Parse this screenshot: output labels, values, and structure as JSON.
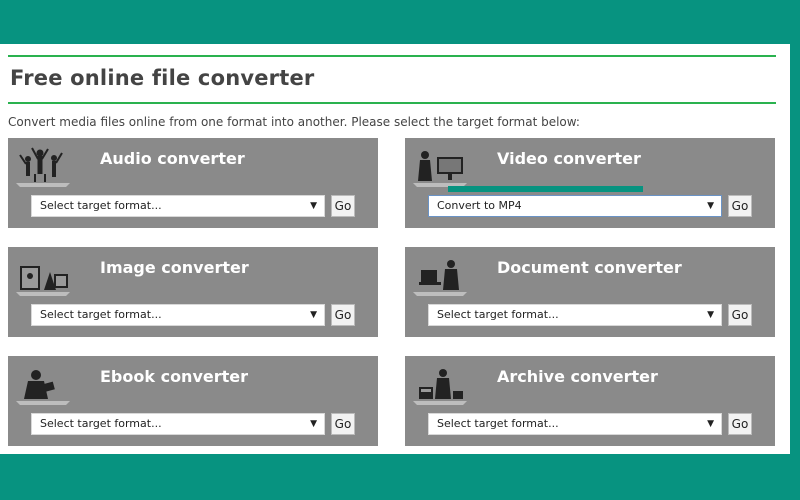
{
  "header": {
    "title": "Free online file converter",
    "subtitle": "Convert media files online from one format into another. Please select the target format below:"
  },
  "colors": {
    "background": "#079380",
    "panel": "#8a8a8a",
    "rule": "#2ab24f"
  },
  "panels": [
    {
      "title": "Audio converter",
      "select": "Select target format...",
      "go": "Go",
      "icon": "audio-silhouette-icon"
    },
    {
      "title": "Video converter",
      "select": "Convert to MP4",
      "go": "Go",
      "icon": "video-silhouette-icon"
    },
    {
      "title": "Image converter",
      "select": "Select target format...",
      "go": "Go",
      "icon": "image-silhouette-icon"
    },
    {
      "title": "Document converter",
      "select": "Select target format...",
      "go": "Go",
      "icon": "document-silhouette-icon"
    },
    {
      "title": "Ebook converter",
      "select": "Select target format...",
      "go": "Go",
      "icon": "ebook-silhouette-icon"
    },
    {
      "title": "Archive converter",
      "select": "Select target format...",
      "go": "Go",
      "icon": "archive-silhouette-icon"
    }
  ]
}
